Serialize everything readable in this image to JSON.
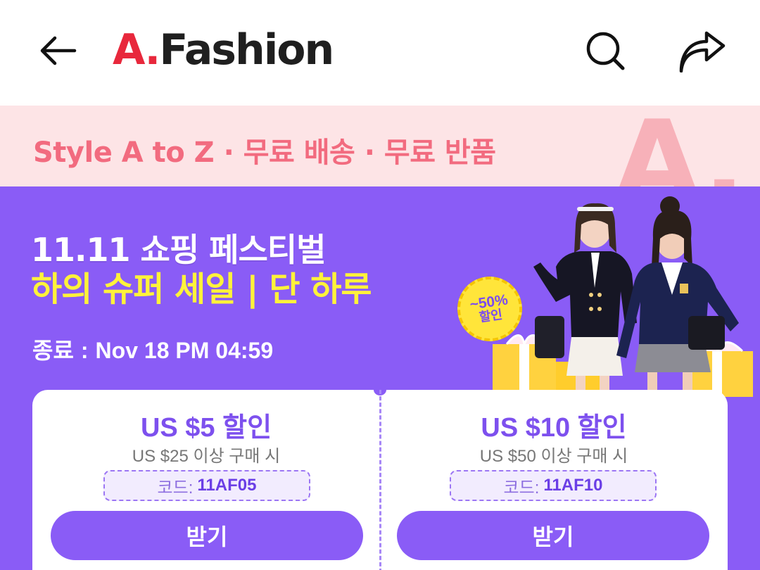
{
  "header": {
    "logo_a": "A.",
    "logo_rest": "Fashion"
  },
  "strip": {
    "text": "Style A to Z · 무료 배송 · 무료 반품",
    "deco": "A."
  },
  "banner": {
    "title_line1": "11.11 쇼핑 페스티벌",
    "title_line2": "하의 슈퍼 세일 | 단 하루",
    "end_label": "종료",
    "end_sep": ":",
    "end_time": "Nov 18 PM 04:59",
    "badge_top": "~50%",
    "badge_bottom": "할인"
  },
  "coupons": [
    {
      "amount": "US $5 할인",
      "condition": "US $25 이상 구매 시",
      "code_label": "코드:",
      "code": "11AF05",
      "button": "받기"
    },
    {
      "amount": "US $10 할인",
      "condition": "US $50 이상 구매 시",
      "code_label": "코드:",
      "code": "11AF10",
      "button": "받기"
    }
  ],
  "icons": {
    "back": "arrow-left-icon",
    "search": "search-icon",
    "share": "share-icon"
  },
  "colors": {
    "brand_red": "#e8283c",
    "banner_purple": "#8a5cf6",
    "accent_yellow": "#fff23a",
    "strip_pink": "#fde4e6"
  }
}
